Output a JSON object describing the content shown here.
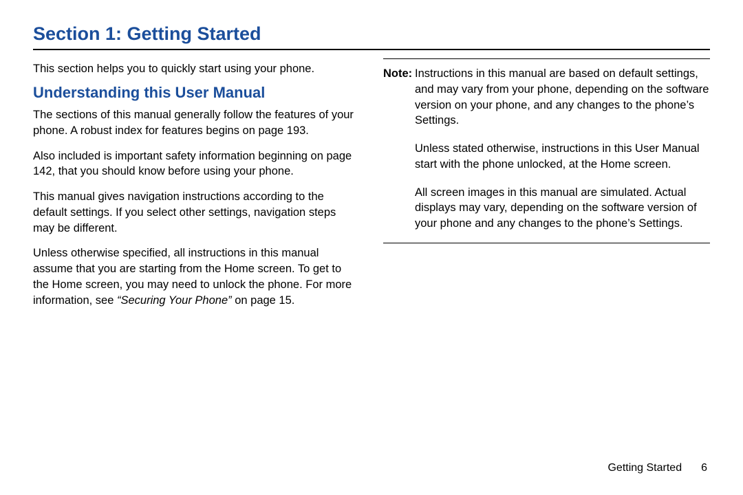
{
  "section_title": "Section 1: Getting Started",
  "left": {
    "intro": "This section helps you to quickly start using your phone.",
    "subheading": "Understanding this User Manual",
    "p1": "The sections of this manual generally follow the features of your phone. A robust index for features begins on page 193.",
    "p2": "Also included is important safety information beginning on page 142, that you should know before using your phone.",
    "p3": "This manual gives navigation instructions according to the default settings. If you select other settings, navigation steps may be different.",
    "p4_a": "Unless otherwise specified, all instructions in this manual assume that you are starting from the Home screen. To get to the Home screen, you may need to unlock the phone. For more information, see ",
    "p4_ref": "“Securing Your Phone”",
    "p4_b": " on page 15."
  },
  "right": {
    "note_label": "Note:",
    "note1": "Instructions in this manual are based on default settings, and may vary from your phone, depending on the software version on your phone, and any changes to the phone’s Settings.",
    "note2": "Unless stated otherwise, instructions in this User Manual start with the phone unlocked, at the Home screen.",
    "note3": "All screen images in this manual are simulated. Actual displays may vary, depending on the software version of your phone and any changes to the phone’s Settings."
  },
  "footer": {
    "label": "Getting Started",
    "page": "6"
  }
}
